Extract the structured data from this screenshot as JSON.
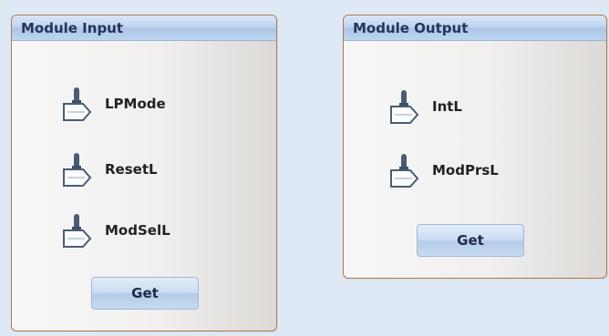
{
  "module_input": {
    "title": "Module Input",
    "signals": [
      {
        "label": "LPMode",
        "icon": "toggle-switch-icon"
      },
      {
        "label": "ResetL",
        "icon": "toggle-switch-icon"
      },
      {
        "label": "ModSelL",
        "icon": "toggle-switch-icon"
      }
    ],
    "get_label": "Get"
  },
  "module_output": {
    "title": "Module Output",
    "signals": [
      {
        "label": "IntL",
        "icon": "toggle-switch-icon"
      },
      {
        "label": "ModPrsL",
        "icon": "toggle-switch-icon"
      }
    ],
    "get_label": "Get"
  },
  "colors": {
    "background": "#dfe9f5",
    "panel_border": "#b07a48",
    "header_text": "#26335a",
    "icon_fill": "#4a5c74"
  }
}
